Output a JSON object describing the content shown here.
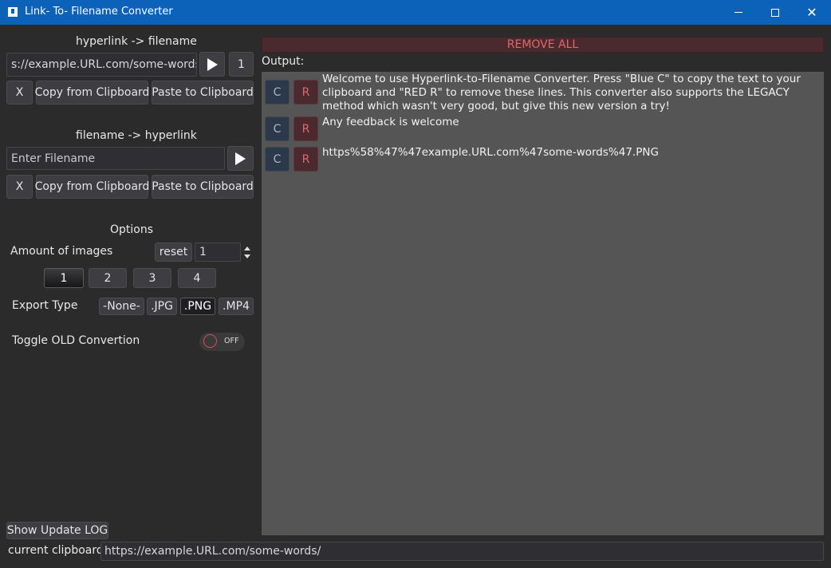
{
  "window": {
    "title": "Link- To- Filename Converter"
  },
  "link_to_file": {
    "heading": "hyperlink -> filename",
    "input_value": "s://example.URL.com/some-words/",
    "count": "1",
    "clear_label": "X",
    "copy_label": "Copy from Clipboard",
    "paste_label": "Paste to Clipboard"
  },
  "file_to_link": {
    "heading": "filename -> hyperlink",
    "input_placeholder": "Enter Filename",
    "clear_label": "X",
    "copy_label": "Copy from Clipboard",
    "paste_label": "Paste to Clipboard"
  },
  "options": {
    "heading": "Options",
    "amount_label": "Amount of images",
    "reset_label": "reset",
    "amount_value": "1",
    "amount_buttons": [
      "1",
      "2",
      "3",
      "4"
    ],
    "amount_selected": "1",
    "export_label": "Export Type",
    "export_types": [
      "-None-",
      ".JPG",
      ".PNG",
      ".MP4"
    ],
    "export_selected": ".PNG",
    "toggle_label": "Toggle OLD Convertion",
    "toggle_state": "OFF"
  },
  "output": {
    "remove_all_label": "REMOVE ALL",
    "label": "Output:",
    "copy_btn": "C",
    "remove_btn": "R",
    "lines": [
      "Welcome to use Hyperlink-to-Filename Converter. Press \"Blue C\" to copy the text to your clipboard and \"RED R\" to remove these lines. This converter also supports the LEGACY method which wasn't very good, but give this new version a try!",
      "Any feedback is welcome",
      "https%58%47%47example.URL.com%47some-words%47.PNG"
    ]
  },
  "footer": {
    "update_log_label": "Show Update LOG",
    "clipboard_label": "current clipboard:",
    "clipboard_value": "https://example.URL.com/some-words/"
  },
  "colors": {
    "titlebar": "#0b62b8",
    "background": "#2b2b2b",
    "output_panel": "#555555",
    "copy_button": "#2c3948",
    "remove_button": "#4a2a2f",
    "remove_text": "#e06868"
  }
}
